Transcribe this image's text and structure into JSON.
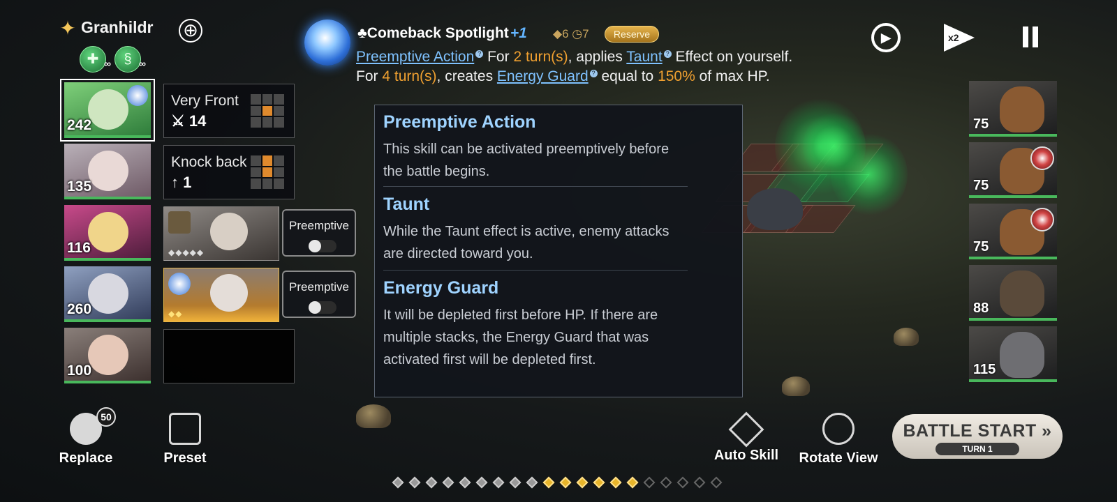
{
  "leader": {
    "name": "Granhildr",
    "buffs": [
      "∞",
      "∞"
    ]
  },
  "team": [
    {
      "hp": "242",
      "selected": true
    },
    {
      "hp": "135"
    },
    {
      "hp": "116"
    },
    {
      "hp": "260"
    },
    {
      "hp": "100"
    }
  ],
  "slots": [
    {
      "title": "Very Front",
      "value": "14"
    },
    {
      "title": "Knock back",
      "value": "1"
    }
  ],
  "preemptive_label": "Preemptive",
  "skill": {
    "name": "Comeback Spotlight",
    "plus": "+1",
    "cost_a": "6",
    "cost_b": "7",
    "reserve": "Reserve",
    "desc": {
      "kw1": "Preemptive Action",
      "t1": " For ",
      "n1": "2 turn(s)",
      "t2": ", applies ",
      "kw2": "Taunt",
      "t3": " Effect on yourself. For ",
      "n2": "4 turn(s)",
      "t4": ", creates ",
      "kw3": "Energy Guard",
      "t5": " equal to ",
      "n3": "150%",
      "t6": " of max HP."
    }
  },
  "tooltip": [
    {
      "title": "Preemptive Action",
      "body": "This skill can be activated preemptively before the battle begins."
    },
    {
      "title": "Taunt",
      "body": "While the Taunt effect is active, enemy attacks are directed toward you."
    },
    {
      "title": "Energy Guard",
      "body": "It will be depleted first before HP. If there are multiple stacks, the Energy Guard that was activated first will be depleted first."
    }
  ],
  "controls": {
    "speed": "x2"
  },
  "enemies": [
    {
      "level": "75",
      "status": false
    },
    {
      "level": "75",
      "status": true
    },
    {
      "level": "75",
      "status": true
    },
    {
      "level": "88",
      "status": false
    },
    {
      "level": "115",
      "status": false
    }
  ],
  "bottom": {
    "replace": "Replace",
    "replace_badge": "50",
    "preset": "Preset",
    "auto_skill": "Auto Skill",
    "rotate_view": "Rotate View",
    "battle_start": "BATTLE START",
    "turn": "TURN 1"
  },
  "progress": {
    "total": 20,
    "filled_from": 9,
    "filled_to": 14,
    "completed": 9
  },
  "colors": {
    "accent_blue": "#7fc2ff",
    "highlight_orange": "#f0a030",
    "hp_green": "#49b85c",
    "reserve_gold": "#d9a53c"
  }
}
